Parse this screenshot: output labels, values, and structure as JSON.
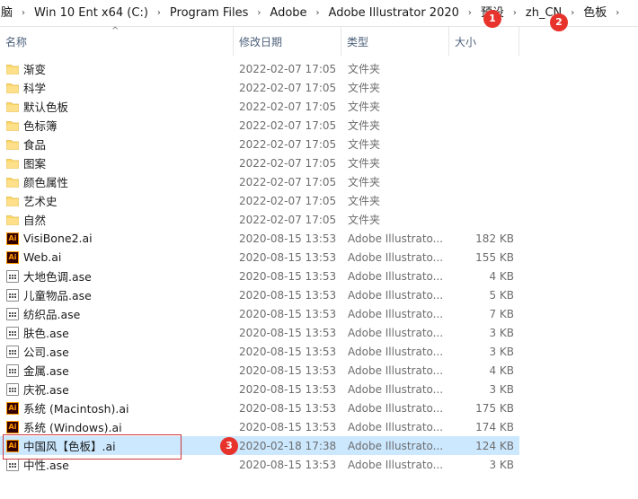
{
  "breadcrumb": {
    "items": [
      {
        "label": "脑"
      },
      {
        "label": "Win 10 Ent x64 (C:)"
      },
      {
        "label": "Program Files"
      },
      {
        "label": "Adobe"
      },
      {
        "label": "Adobe Illustrator 2020"
      },
      {
        "label": "预设"
      },
      {
        "label": "zh_CN"
      },
      {
        "label": "色板"
      }
    ],
    "separator": "›"
  },
  "columns": {
    "name": "名称",
    "date": "修改日期",
    "type": "类型",
    "size": "大小"
  },
  "rows": [
    {
      "name": "渐变",
      "date": "2022-02-07 17:05",
      "type": "文件夹",
      "size": "",
      "icon": "folder"
    },
    {
      "name": "科学",
      "date": "2022-02-07 17:05",
      "type": "文件夹",
      "size": "",
      "icon": "folder"
    },
    {
      "name": "默认色板",
      "date": "2022-02-07 17:05",
      "type": "文件夹",
      "size": "",
      "icon": "folder"
    },
    {
      "name": "色标簿",
      "date": "2022-02-07 17:05",
      "type": "文件夹",
      "size": "",
      "icon": "folder"
    },
    {
      "name": "食品",
      "date": "2022-02-07 17:05",
      "type": "文件夹",
      "size": "",
      "icon": "folder"
    },
    {
      "name": "图案",
      "date": "2022-02-07 17:05",
      "type": "文件夹",
      "size": "",
      "icon": "folder"
    },
    {
      "name": "颜色属性",
      "date": "2022-02-07 17:05",
      "type": "文件夹",
      "size": "",
      "icon": "folder"
    },
    {
      "name": "艺术史",
      "date": "2022-02-07 17:05",
      "type": "文件夹",
      "size": "",
      "icon": "folder"
    },
    {
      "name": "自然",
      "date": "2022-02-07 17:05",
      "type": "文件夹",
      "size": "",
      "icon": "folder"
    },
    {
      "name": "VisiBone2.ai",
      "date": "2020-08-15 13:53",
      "type": "Adobe Illustrato...",
      "size": "182 KB",
      "icon": "ai"
    },
    {
      "name": "Web.ai",
      "date": "2020-08-15 13:53",
      "type": "Adobe Illustrato...",
      "size": "155 KB",
      "icon": "ai"
    },
    {
      "name": "大地色调.ase",
      "date": "2020-08-15 13:53",
      "type": "Adobe Illustrato...",
      "size": "4 KB",
      "icon": "ase"
    },
    {
      "name": "儿童物品.ase",
      "date": "2020-08-15 13:53",
      "type": "Adobe Illustrato...",
      "size": "5 KB",
      "icon": "ase"
    },
    {
      "name": "纺织品.ase",
      "date": "2020-08-15 13:53",
      "type": "Adobe Illustrato...",
      "size": "7 KB",
      "icon": "ase"
    },
    {
      "name": "肤色.ase",
      "date": "2020-08-15 13:53",
      "type": "Adobe Illustrato...",
      "size": "3 KB",
      "icon": "ase"
    },
    {
      "name": "公司.ase",
      "date": "2020-08-15 13:53",
      "type": "Adobe Illustrato...",
      "size": "3 KB",
      "icon": "ase"
    },
    {
      "name": "金属.ase",
      "date": "2020-08-15 13:53",
      "type": "Adobe Illustrato...",
      "size": "4 KB",
      "icon": "ase"
    },
    {
      "name": "庆祝.ase",
      "date": "2020-08-15 13:53",
      "type": "Adobe Illustrato...",
      "size": "3 KB",
      "icon": "ase"
    },
    {
      "name": "系统 (Macintosh).ai",
      "date": "2020-08-15 13:53",
      "type": "Adobe Illustrato...",
      "size": "175 KB",
      "icon": "ai"
    },
    {
      "name": "系统 (Windows).ai",
      "date": "2020-08-15 13:53",
      "type": "Adobe Illustrato...",
      "size": "174 KB",
      "icon": "ai"
    },
    {
      "name": "中国风【色板】.ai",
      "date": "2020-02-18 17:38",
      "type": "Adobe Illustrato...",
      "size": "124 KB",
      "icon": "ai",
      "selected": true
    },
    {
      "name": "中性.ase",
      "date": "2020-08-15 13:53",
      "type": "Adobe Illustrato...",
      "size": "3 KB",
      "icon": "ase"
    }
  ],
  "annotations": [
    {
      "label": "1"
    },
    {
      "label": "2"
    },
    {
      "label": "3"
    }
  ],
  "colors": {
    "selection": "#cce8ff",
    "badge": "#e8332c",
    "folder": "#ffd866"
  }
}
